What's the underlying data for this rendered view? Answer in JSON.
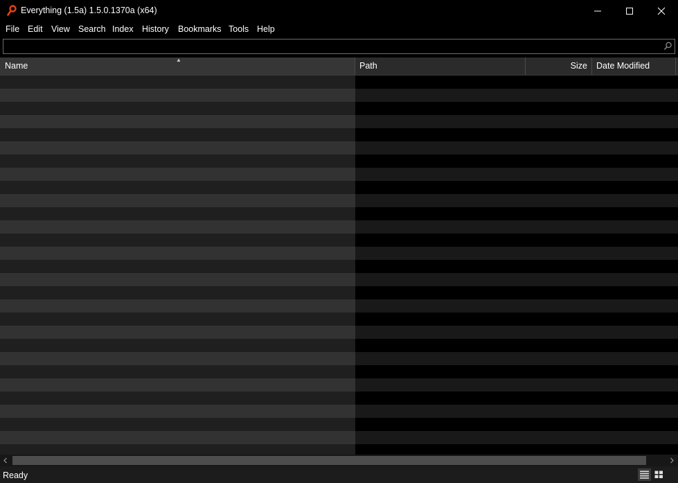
{
  "window": {
    "title": "Everything (1.5a) 1.5.0.1370a (x64)",
    "app_icon": "magnifier-icon"
  },
  "window_controls": {
    "minimize_icon": "minimize-icon",
    "maximize_icon": "maximize-icon",
    "close_icon": "close-icon"
  },
  "menu": {
    "items": [
      {
        "label": "File"
      },
      {
        "label": "Edit"
      },
      {
        "label": "View"
      },
      {
        "label": "Search"
      },
      {
        "label": "Index"
      },
      {
        "label": "History"
      },
      {
        "label": "Bookmarks"
      },
      {
        "label": "Tools"
      },
      {
        "label": "Help"
      }
    ]
  },
  "search": {
    "value": "",
    "placeholder": "",
    "icon": "search-icon"
  },
  "results": {
    "columns": [
      {
        "label": "Name",
        "sorted": "ascending"
      },
      {
        "label": "Path"
      },
      {
        "label": "Size"
      },
      {
        "label": "Date Modified"
      }
    ],
    "rows": []
  },
  "status": {
    "text": "Ready",
    "view_details_icon": "details-view-icon",
    "view_thumbnails_icon": "thumbnails-view-icon"
  },
  "colors": {
    "accent_icon": "#e8411b",
    "background": "#000000",
    "row_dark": "#1f1f1f",
    "row_light": "#323232"
  }
}
